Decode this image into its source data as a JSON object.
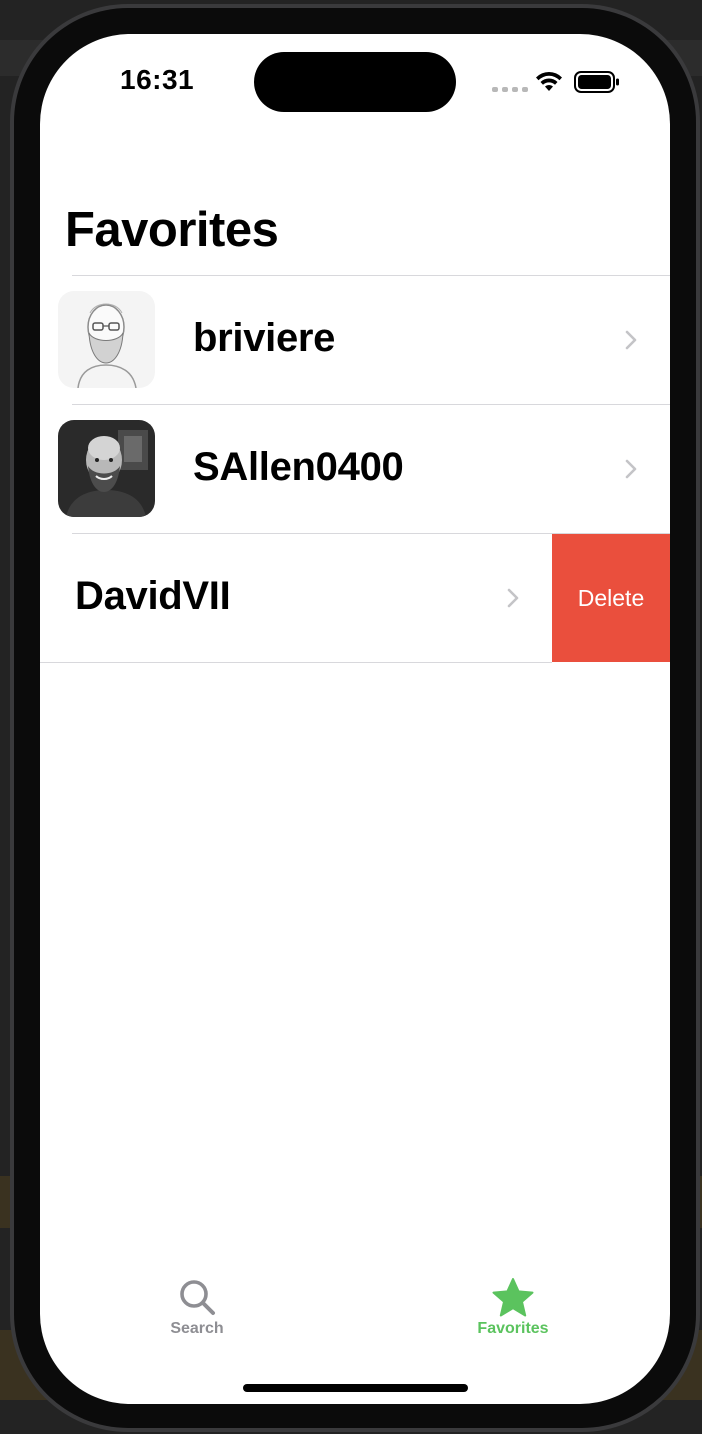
{
  "status_bar": {
    "time": "16:31",
    "icons": [
      "cellular-dots-icon",
      "wifi-icon",
      "battery-icon"
    ]
  },
  "header": {
    "title": "Favorites"
  },
  "favorites": [
    {
      "username": "briviere",
      "avatar": "sketch-portrait-avatar"
    },
    {
      "username": "SAllen0400",
      "avatar": "photo-portrait-avatar"
    },
    {
      "username": "DavidVII",
      "avatar": "none",
      "swiped": true,
      "action_label": "Delete"
    }
  ],
  "tab_bar": {
    "tabs": [
      {
        "label": "Search",
        "icon": "magnifying-glass-icon",
        "selected": false
      },
      {
        "label": "Favorites",
        "icon": "star-icon",
        "selected": true
      }
    ]
  },
  "colors": {
    "accent": "#5bc35e",
    "destructive": "#ea4f3d",
    "inactive_tab": "#8e8e93",
    "chevron": "#c4c4c7"
  }
}
